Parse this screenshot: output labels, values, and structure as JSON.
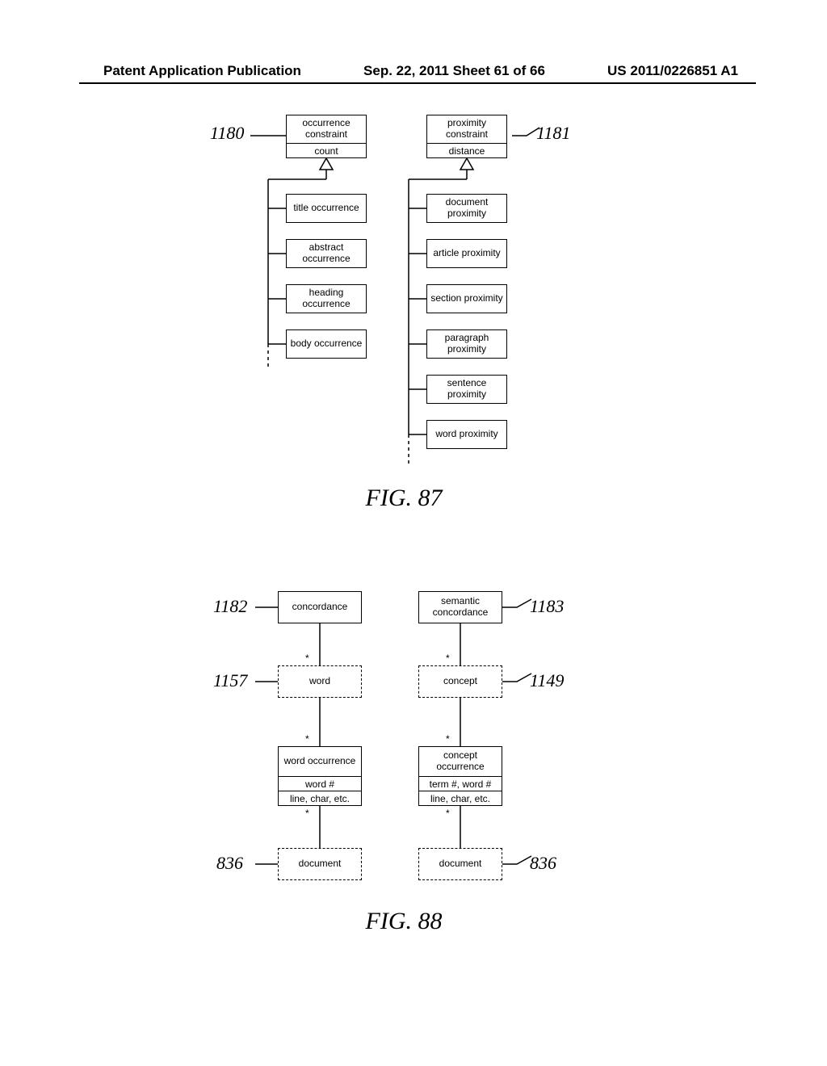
{
  "header": {
    "left": "Patent Application Publication",
    "center": "Sep. 22, 2011  Sheet 61 of 66",
    "right": "US 2011/0226851 A1"
  },
  "fig87": {
    "label": "FIG. 87",
    "left": {
      "ref": "1180",
      "parent": {
        "title": "occurrence constraint",
        "attr": "count"
      },
      "children": [
        "title occurrence",
        "abstract occurrence",
        "heading occurrence",
        "body occurrence"
      ]
    },
    "right": {
      "ref": "1181",
      "parent": {
        "title": "proximity constraint",
        "attr": "distance"
      },
      "children": [
        "document proximity",
        "article proximity",
        "section proximity",
        "paragraph proximity",
        "sentence proximity",
        "word proximity"
      ]
    }
  },
  "fig88": {
    "label": "FIG. 88",
    "left": {
      "concordance": {
        "label": "concordance",
        "ref": "1182"
      },
      "word": {
        "label": "word",
        "ref": "1157"
      },
      "occurrence": {
        "title": "word occurrence",
        "attr1": "word #",
        "attr2": "line, char, etc."
      },
      "document": {
        "label": "document",
        "ref": "836"
      }
    },
    "right": {
      "concordance": {
        "label": "semantic concordance",
        "ref": "1183"
      },
      "concept": {
        "label": "concept",
        "ref": "1149"
      },
      "occurrence": {
        "title": "concept occurrence",
        "attr1": "term #, word #",
        "attr2": "line, char, etc."
      },
      "document": {
        "label": "document",
        "ref": "836"
      }
    }
  }
}
